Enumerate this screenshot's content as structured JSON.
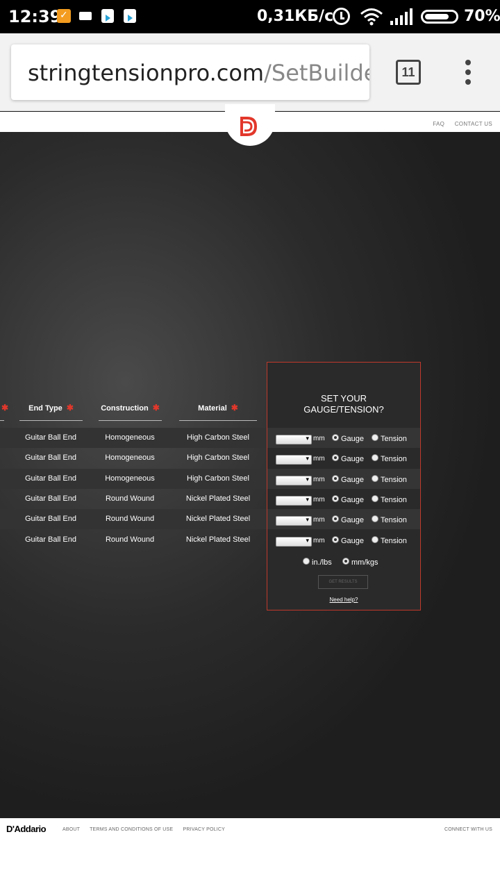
{
  "status_bar": {
    "time": "12:39",
    "network_speed": "0,31КБ/с",
    "battery": "70%"
  },
  "browser": {
    "url_host": "stringtensionpro.com",
    "url_path": "/SetBuilder?",
    "tab_count": "11"
  },
  "header": {
    "links": [
      "FAQ",
      "CONTACT US"
    ]
  },
  "table": {
    "columns": [
      "End Type",
      "Construction",
      "Material"
    ],
    "rows": [
      {
        "end_type": "Guitar Ball End",
        "construction": "Homogeneous",
        "material": "High Carbon Steel"
      },
      {
        "end_type": "Guitar Ball End",
        "construction": "Homogeneous",
        "material": "High Carbon Steel"
      },
      {
        "end_type": "Guitar Ball End",
        "construction": "Homogeneous",
        "material": "High Carbon Steel"
      },
      {
        "end_type": "Guitar Ball End",
        "construction": "Round Wound",
        "material": "Nickel Plated Steel"
      },
      {
        "end_type": "Guitar Ball End",
        "construction": "Round Wound",
        "material": "Nickel Plated Steel"
      },
      {
        "end_type": "Guitar Ball End",
        "construction": "Round Wound",
        "material": "Nickel Plated Steel"
      }
    ]
  },
  "panel": {
    "title_line1": "SET YOUR",
    "title_line2": "GAUGE/TENSION?",
    "unit": "mm",
    "gauge_label": "Gauge",
    "tension_label": "Tension",
    "selected_mode": "Gauge",
    "units_option_1": "in./lbs",
    "units_option_2": "mm/kgs",
    "selected_units": "mm/kgs",
    "get_results": "GET RESULTS",
    "need_help": "Need help?"
  },
  "footer": {
    "brand": "D'Addario",
    "links": [
      "ABOUT",
      "TERMS AND CONDITIONS OF USE",
      "PRIVACY POLICY"
    ],
    "connect": "CONNECT WITH US"
  },
  "colors": {
    "accent": "#e2372b",
    "panel_border": "#c0392b",
    "background": "#1e1e1e"
  }
}
